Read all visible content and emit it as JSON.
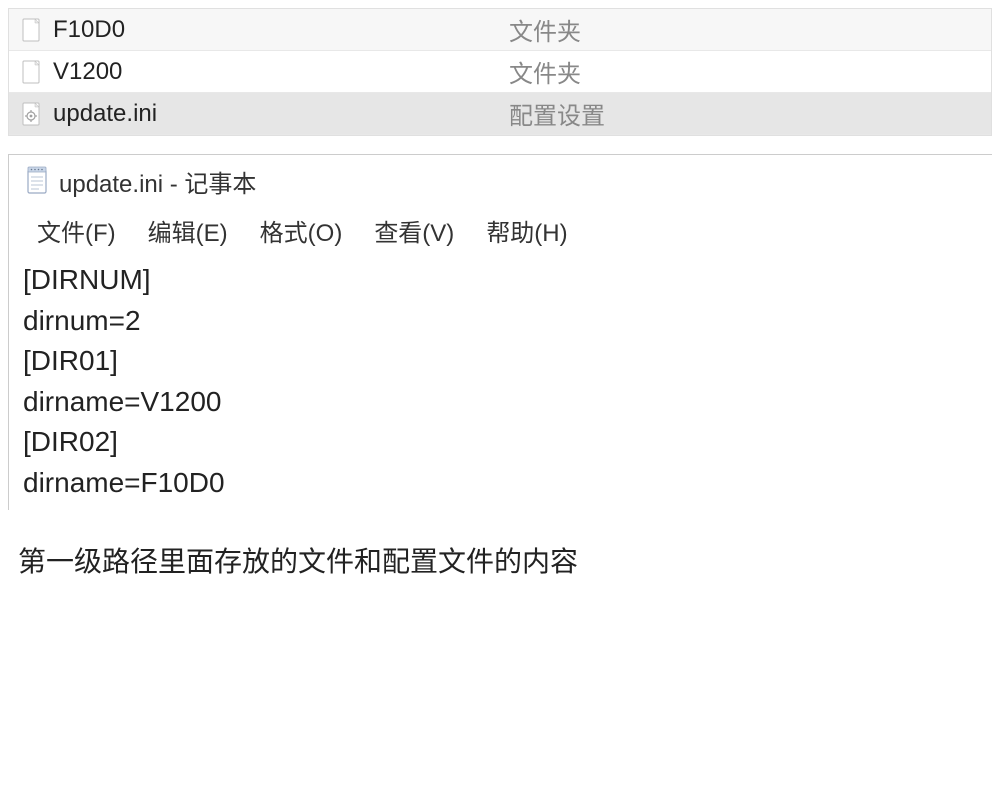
{
  "file_list": {
    "rows": [
      {
        "name": "F10D0",
        "type": "文件夹",
        "icon": "folder"
      },
      {
        "name": "V1200",
        "type": "文件夹",
        "icon": "folder"
      },
      {
        "name": "update.ini",
        "type": "配置设置",
        "icon": "ini",
        "selected": true
      }
    ]
  },
  "notepad": {
    "icon": "notepad",
    "title": "update.ini - 记事本",
    "menu": {
      "file": "文件(F)",
      "edit": "编辑(E)",
      "format": "格式(O)",
      "view": "查看(V)",
      "help": "帮助(H)"
    },
    "content": "[DIRNUM]\ndirnum=2\n[DIR01]\ndirname=V1200\n[DIR02]\ndirname=F10D0"
  },
  "caption": "第一级路径里面存放的文件和配置文件的内容"
}
